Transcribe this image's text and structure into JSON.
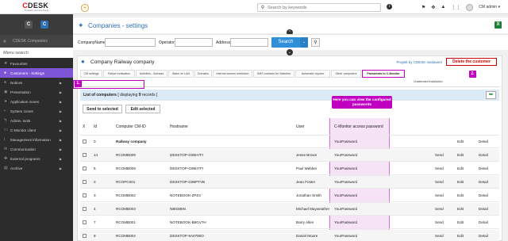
{
  "logo": {
    "brand_c": "C",
    "brand_rest": "DESK",
    "reg": "®",
    "tagline": "Powerful Service Desk"
  },
  "sidebar": {
    "collapse_text": "CDESK Companies",
    "search_placeholder": "Menu search",
    "items": [
      {
        "label": "Favourites",
        "icon": "star-icon",
        "glyph": "★"
      },
      {
        "label": "Customers - Settings",
        "icon": "users-icon",
        "glyph": "●"
      },
      {
        "label": "Notices",
        "icon": "bell-icon",
        "glyph": "●"
      },
      {
        "label": "Presentation",
        "icon": "eye-icon",
        "glyph": "◉"
      },
      {
        "label": "Application zones",
        "icon": "pointer-icon",
        "glyph": "➤"
      },
      {
        "label": "System zones",
        "icon": "lock-icon",
        "glyph": "▪"
      },
      {
        "label": "Admin. tools",
        "icon": "wrench-icon",
        "glyph": "✎"
      },
      {
        "label": "C-Monitor client",
        "icon": "monitor-icon",
        "glyph": "▭"
      },
      {
        "label": "Management information",
        "icon": "info-icon",
        "glyph": "i"
      },
      {
        "label": "Communication",
        "icon": "chat-icon",
        "glyph": "✉"
      },
      {
        "label": "External programs",
        "icon": "puzzle-icon",
        "glyph": "✤"
      },
      {
        "label": "Archive",
        "icon": "archive-icon",
        "glyph": "▤"
      }
    ]
  },
  "header": {
    "search_placeholder": "Search by keywords",
    "admin_label": "CM admin",
    "user_glyph": "▾"
  },
  "page": {
    "title": "Companies - settings"
  },
  "filters": {
    "company_label": "CompanyName",
    "operator_label": "Operator",
    "address_label": "Address",
    "search_label": "Search",
    "search_caret": "⌄"
  },
  "customer": {
    "name": "Company Railway company",
    "project_link": "Projekt by CDESK nastavení",
    "delete_label": "Delete the customer"
  },
  "tabs": [
    "CM settings",
    "Failure evaluation",
    "Activities - licenses",
    "Wake on LAN",
    "Domains",
    "Internet access restriction",
    "SMS contacts for Watches",
    "Automatic reports",
    "Other computers",
    "Passwords to C-Monitor"
  ],
  "subtab": "Unattended installation",
  "list": {
    "title_prefix": "List of computers",
    "title_mid": "[ displaying ",
    "count": "9",
    "title_suffix": " records ]"
  },
  "actions": {
    "send_selected": "Send to selected",
    "edit_selected": "Edit selected"
  },
  "table": {
    "columns": {
      "x": "X",
      "id": "Id",
      "cmid": "Computer CM-ID",
      "host": "Hostname",
      "user": "User",
      "pw": "C-Monitor access password"
    },
    "rows": [
      {
        "id": "0",
        "cmid": "Railway company",
        "host": "",
        "user": "",
        "pw": "YourPassword",
        "send": "",
        "edit": "Edit",
        "detail": "Detail",
        "bold": true
      },
      {
        "id": "14",
        "cmid": "RCOMB009",
        "host": "DESKTOP-G95H7FI",
        "user": "Jesse Brown",
        "pw": "YourPassword",
        "send": "Send",
        "edit": "Edit",
        "detail": "Detail"
      },
      {
        "id": "5",
        "cmid": "RCOMB009",
        "host": "DESKTOP-G95H7FI",
        "user": "Paul Webber",
        "pw": "YourPassword",
        "send": "Send",
        "edit": "Edit",
        "detail": "Detail"
      },
      {
        "id": "2",
        "cmid": "RCOPC001",
        "host": "DESKTOP-G96PTVB",
        "user": "Jean Foster",
        "pw": "YourPassword",
        "send": "Send",
        "edit": "Edit",
        "detail": "Detail"
      },
      {
        "id": "3",
        "cmid": "RCOMB002",
        "host": "NOTEBOOK-ZPZ4",
        "user": "Jonathan Smith",
        "pw": "YourPassword",
        "send": "Send",
        "edit": "Edit",
        "detail": "Detail"
      },
      {
        "id": "4",
        "cmid": "RCOMB003",
        "host": "NB0385N",
        "user": "Michael Mayweather",
        "pw": "YourPassword",
        "send": "Send",
        "edit": "Edit",
        "detail": "Detail"
      },
      {
        "id": "7",
        "cmid": "RCOMB001",
        "host": "NOTEBOOK-B8GV7H",
        "user": "Barry Allen",
        "pw": "YourPassword",
        "send": "Send",
        "edit": "Edit",
        "detail": "Detail"
      },
      {
        "id": "9",
        "cmid": "RCOMB004",
        "host": "DESKTOP-9A0790O",
        "user": "Daniel Moore",
        "pw": "YourPassword",
        "send": "Send",
        "edit": "Edit",
        "detail": "Detail"
      }
    ]
  },
  "annotations": {
    "badge1": "1.",
    "badge2": "2.",
    "callout": "Here you can view the configured passwords"
  },
  "colors": {
    "accent": "#c000c0",
    "active_menu": "#7c56d6",
    "primary": "#2f6fb4"
  }
}
